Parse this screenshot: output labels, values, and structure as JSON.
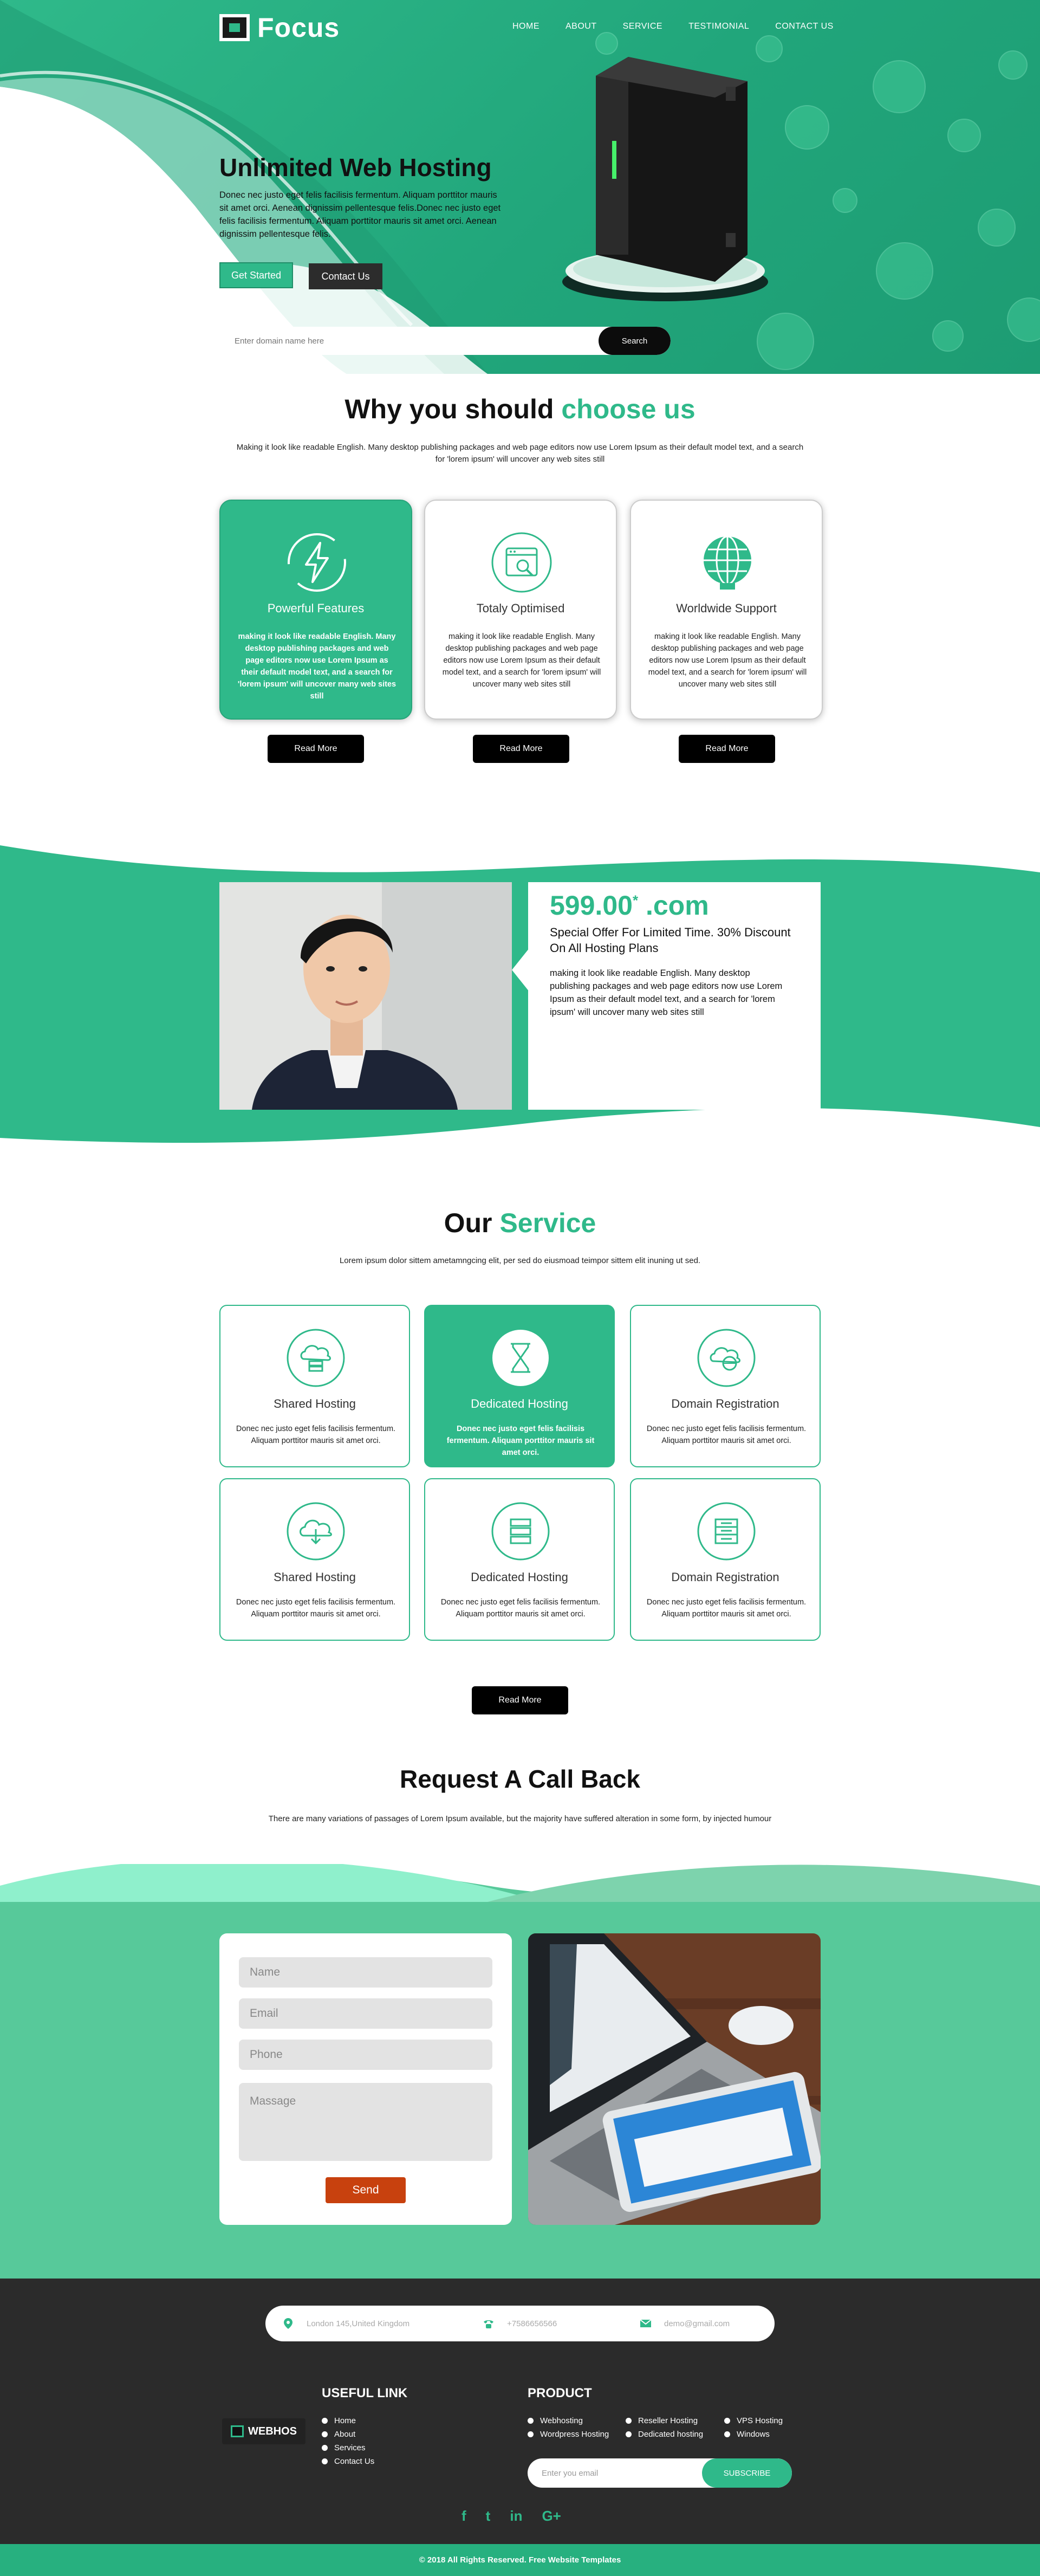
{
  "brand": {
    "name": "Focus",
    "accent": "#2fb98a",
    "dark": "#2b2b2b"
  },
  "nav": {
    "items": [
      "HOME",
      "ABOUT",
      "SERVICE",
      "TESTIMONIAL",
      "CONTACT US"
    ]
  },
  "hero": {
    "title": "Unlimited Web Hosting",
    "text": "Donec nec justo eget felis facilisis fermentum. Aliquam porttitor mauris sit amet orci. Aenean dignissim pellentesque felis.Donec nec justo eget felis facilisis fermentum. Aliquam porttitor mauris sit amet orci. Aenean dignissim pellentesque felis.",
    "btn_started": "Get Started",
    "btn_contact": "Contact Us",
    "domain_placeholder": "Enter domain name here",
    "search_label": "Search"
  },
  "why": {
    "title_a": "Why you should",
    "title_b": "choose us",
    "sub": "Making it look like readable English. Many desktop publishing packages and web page editors now use Lorem Ipsum as their default model text, and a search for 'lorem ipsum' will uncover any web sites still",
    "cards": [
      {
        "title": "Powerful Features",
        "icon": "lightning-refresh-icon",
        "text": "making it look like readable English. Many desktop publishing packages and web page editors now use Lorem Ipsum as their default model text, and a search for 'lorem ipsum' will uncover many web sites still",
        "button": "Read More"
      },
      {
        "title": "Totaly Optimised",
        "icon": "browser-search-icon",
        "text": "making it look like readable English. Many desktop publishing packages and web page editors now use Lorem Ipsum as their default model text, and a search for 'lorem ipsum' will uncover many web sites still",
        "button": "Read More"
      },
      {
        "title": "Worldwide Support",
        "icon": "globe-icon",
        "text": "making it look like readable English. Many desktop publishing packages and web page editors now use Lorem Ipsum as their default model text, and a search for 'lorem ipsum' will uncover many web sites still",
        "button": "Read More"
      }
    ]
  },
  "offer": {
    "price": "599.00",
    "price_sup": "*",
    "price_suffix": " .com",
    "heading": "Special Offer For Limited Time. 30% Discount On All Hosting Plans",
    "text": "making it look like readable English. Many desktop publishing packages and web page editors now use Lorem Ipsum as their default model text, and a search for 'lorem ipsum' will uncover many web sites still"
  },
  "service": {
    "title_a": "Our",
    "title_b": "Service",
    "sub": "Lorem ipsum dolor sittem ametamngcing elit, per sed do eiusmoad teimpor sittem elit inuning ut sed.",
    "cards": [
      {
        "title": "Shared Hosting",
        "icon": "cloud-server-icon",
        "text": "Donec nec justo eget felis facilisis fermentum. Aliquam porttitor mauris sit amet orci."
      },
      {
        "title": "Dedicated Hosting",
        "icon": "hourglass-icon",
        "text": "Donec nec justo eget felis facilisis fermentum. Aliquam porttitor mauris sit amet orci."
      },
      {
        "title": "Domain Registration",
        "icon": "cloud-globe-icon",
        "text": "Donec nec justo eget felis facilisis fermentum. Aliquam porttitor mauris sit amet orci."
      },
      {
        "title": "Shared Hosting",
        "icon": "cloud-download-icon",
        "text": "Donec nec justo eget felis facilisis fermentum. Aliquam porttitor mauris sit amet orci."
      },
      {
        "title": "Dedicated Hosting",
        "icon": "server-stack-icon",
        "text": "Donec nec justo eget felis facilisis fermentum. Aliquam porttitor mauris sit amet orci."
      },
      {
        "title": "Domain Registration",
        "icon": "database-list-icon",
        "text": "Donec nec justo eget felis facilisis fermentum. Aliquam porttitor mauris sit amet orci."
      }
    ],
    "button": "Read More"
  },
  "callback": {
    "title": "Request A Call Back",
    "sub": "There are many variations of passages of Lorem Ipsum available, but the majority have suffered alteration in some form, by injected humour",
    "name_ph": "Name",
    "email_ph": "Email",
    "phone_ph": "Phone",
    "message_ph": "Massage",
    "send": "Send"
  },
  "footer": {
    "address": "London 145,United Kingdom",
    "phone": "+7586656566",
    "email": "demo@gmail.com",
    "logo": "WEBHOS",
    "useful_title": "USEFUL LINK",
    "useful_links": [
      "Home",
      "About",
      "Services",
      "Contact Us"
    ],
    "product_title": "PRODUCT",
    "product_col1": [
      "Webhosting",
      "Wordpress Hosting"
    ],
    "product_col2": [
      "Reseller Hosting",
      "Dedicated hosting"
    ],
    "product_col3": [
      "VPS Hosting",
      "Windows"
    ],
    "subscribe_ph": "Enter you email",
    "subscribe_btn": "SUBSCRIBE",
    "social": [
      "f",
      "t",
      "in",
      "G+"
    ],
    "copyright": "© 2018 All Rights Reserved. Free Website Templates"
  }
}
